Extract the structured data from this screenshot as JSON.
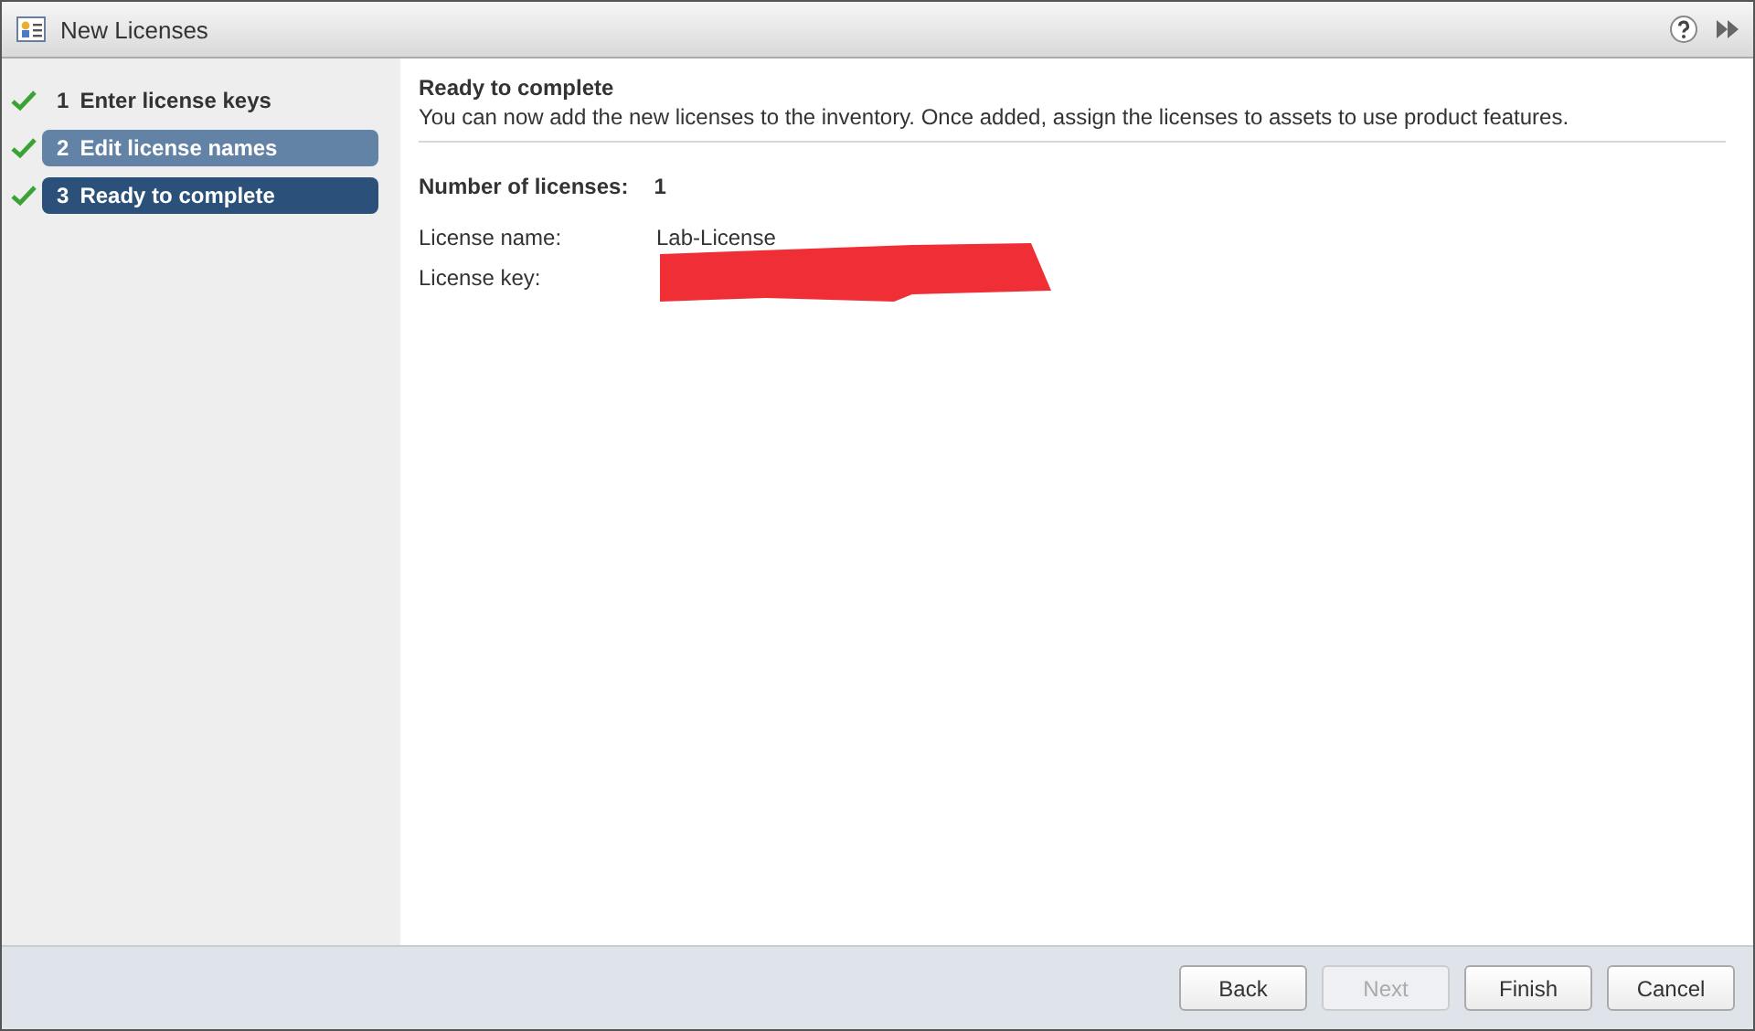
{
  "window": {
    "title": "New Licenses"
  },
  "steps": [
    {
      "number": "1",
      "label": "Enter license keys",
      "done": true,
      "selected": false,
      "hovered": false
    },
    {
      "number": "2",
      "label": "Edit license names",
      "done": true,
      "selected": false,
      "hovered": true
    },
    {
      "number": "3",
      "label": "Ready to complete",
      "done": true,
      "selected": true,
      "hovered": false
    }
  ],
  "content": {
    "heading": "Ready to complete",
    "description": "You can now add the new licenses to the inventory. Once added, assign the licenses to assets to use product features.",
    "count_label": "Number of licenses:",
    "count_value": "1",
    "fields": [
      {
        "label": "License name:",
        "value": "Lab-License",
        "redacted": false
      },
      {
        "label": "License key:",
        "redacted": true
      }
    ]
  },
  "buttons": [
    {
      "label": "Back",
      "disabled": false
    },
    {
      "label": "Next",
      "disabled": true
    },
    {
      "label": "Finish",
      "disabled": false
    },
    {
      "label": "Cancel",
      "disabled": false
    }
  ]
}
